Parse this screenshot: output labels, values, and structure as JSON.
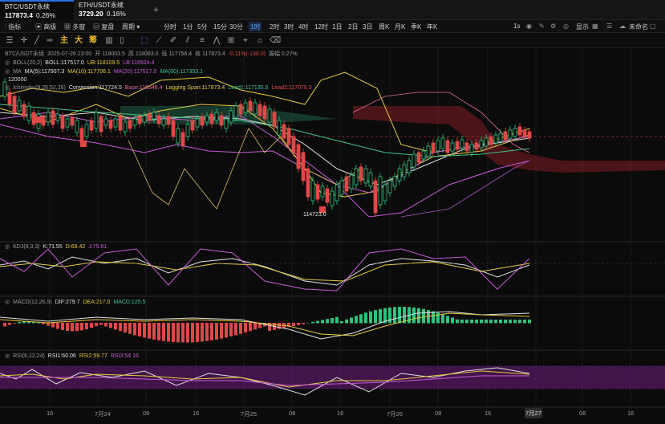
{
  "tabs": [
    {
      "name": "BTC/USDT永续",
      "price": "117873.4",
      "change": "0.26%",
      "active": true
    },
    {
      "name": "ETH/USDT永续",
      "price": "3729.20",
      "change": "0.16%",
      "active": false
    }
  ],
  "toolbar": {
    "indicator": "指标",
    "alert": "高级",
    "multi": "多窗",
    "replay": "复盘",
    "period": "周期",
    "timeframes": [
      "分时",
      "1分",
      "5分",
      "15分",
      "30分",
      "1时",
      "2时",
      "3时",
      "4时",
      "12时",
      "1日",
      "2日",
      "3日",
      "周K",
      "月K",
      "季K",
      "年K"
    ],
    "selected_tf": "1时",
    "right": {
      "interval": "1s",
      "display": "显示",
      "layout": "未命名"
    }
  },
  "drawtools": {
    "colors": [
      "主",
      "大",
      "筹"
    ]
  },
  "legends": {
    "header": {
      "symbol": "BTC/USDT永续",
      "time": "2025-07-26 23:00",
      "o": "开 118003.5",
      "h": "高 118083.0",
      "l": "低 117756.4",
      "c": "收 117873.4",
      "chg": "-0.11%(-130.0)",
      "amp": "振幅 0.27%"
    },
    "boll": {
      "name": "BOLL(20,2)",
      "mid": "BOLL:117517.0",
      "up": "UB:118109.5",
      "lb": "LB:116924.4"
    },
    "ma": {
      "name": "MA",
      "ma5": "MA(5):117907.3",
      "ma10": "MA(10):117706.1",
      "ma20": "MA(20):117517.0",
      "ma60": "MA(60):117353.1"
    },
    "ichimoku": {
      "name": "Ichimoku(9,26,52,26)",
      "conv": "Conversion:117724.5",
      "base": "Base:116546.4",
      "lag": "Lagging Span:117873.4",
      "lead1": "Lead1:117135.5",
      "lead2": "Lead2:117079.3"
    },
    "kdj": {
      "name": "KDJ(9,3,3)",
      "k": "K:71.55",
      "d": "D:69.42",
      "j": "J:75.81"
    },
    "macd": {
      "name": "MACD(12,26,9)",
      "dif": "DIF:279.7",
      "dea": "DEA:217.0",
      "macd": "MACD:125.5"
    },
    "rsi": {
      "name": "RSI(6,12,24)",
      "r1": "RSI1:60.06",
      "r2": "RSI2:59.77",
      "r3": "RSI3:54.16"
    }
  },
  "price_labels": {
    "high": "120000",
    "low": "114723.0",
    "high_prefix": "1"
  },
  "xaxis": [
    "16",
    "7月24",
    "08",
    "16",
    "7月25",
    "08",
    "16",
    "7月26",
    "08",
    "16",
    "7月27",
    "08",
    "16"
  ],
  "current_date": "7月27",
  "colors": {
    "up": "#2ec27e",
    "down": "#e04848",
    "accent": "#2f6fe6"
  }
}
